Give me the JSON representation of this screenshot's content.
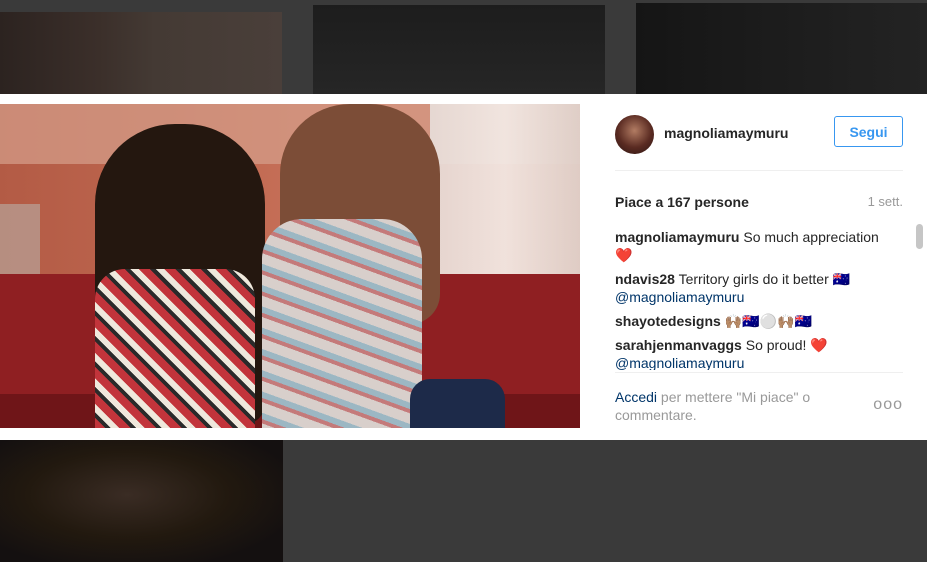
{
  "post": {
    "username": "magnoliamaymuru",
    "follow_label": "Segui",
    "likes_text": "Piace a 167 persone",
    "time_ago": "1 sett.",
    "comments": [
      {
        "user": "magnoliamaymuru",
        "text": "So much appreciation",
        "suffix": "❤️",
        "mention": ""
      },
      {
        "user": "ndavis28",
        "text": "Territory girls do it better 🇦🇺",
        "suffix": "",
        "mention": "@magnoliamaymuru"
      },
      {
        "user": "shayotedesigns",
        "text": "🙌🏽🇦🇺⚪🙌🏽🇦🇺",
        "suffix": "",
        "mention": ""
      },
      {
        "user": "sarahjenmanvaggs",
        "text": "So proud!",
        "suffix": "❤️",
        "mention": "@magnoliamaymuru"
      }
    ],
    "login_link": "Accedi",
    "login_text": " per mettere \"Mi piace\" o commentare.",
    "more_label": "ooo"
  },
  "icons": {
    "avatar": "profile-avatar",
    "more": "more-options-icon",
    "heart": "heart-emoji"
  },
  "colors": {
    "accent": "#3897f0",
    "mention": "#003569",
    "muted": "#999999",
    "text": "#262626"
  }
}
